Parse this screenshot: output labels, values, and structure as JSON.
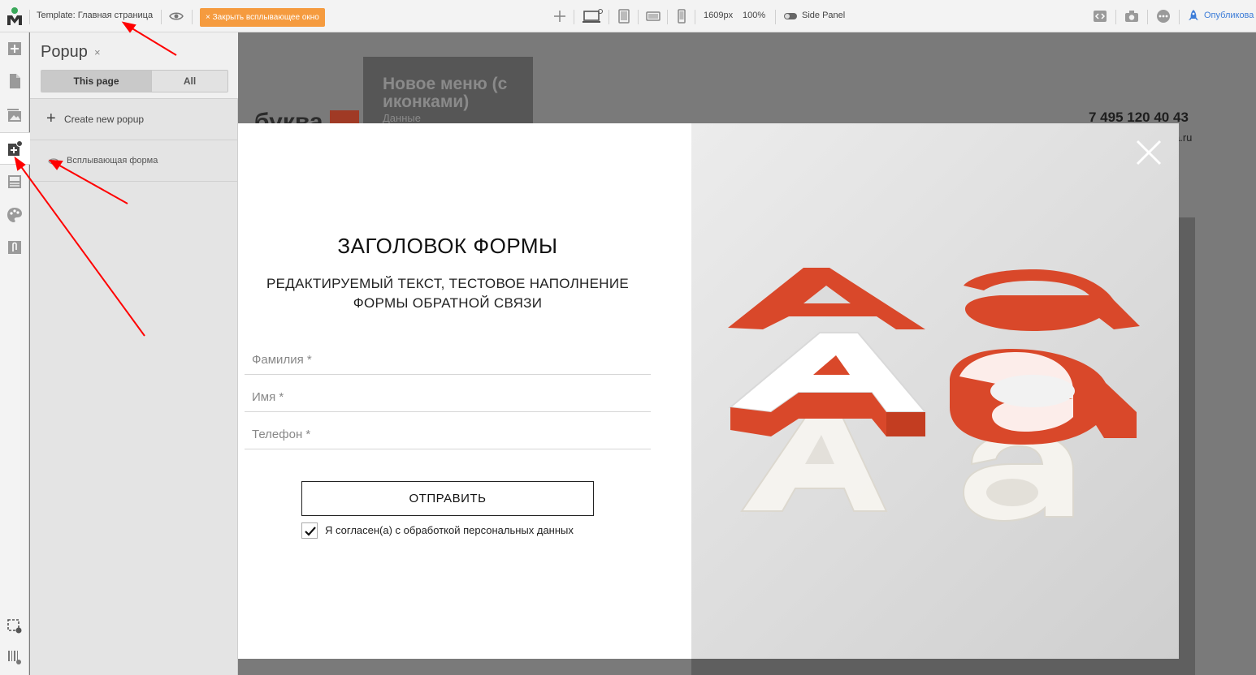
{
  "toolbar": {
    "template_label": "Template: Главная страница",
    "close_popup_label": "Закрыть всплывающее окно",
    "width_value": "1609px",
    "zoom_value": "100%",
    "side_panel_label": "Side Panel",
    "publish_label": "Опубликова"
  },
  "panel": {
    "title": "Popup",
    "close_glyph": "×",
    "tabs": [
      {
        "label": "This page",
        "active": true
      },
      {
        "label": "All",
        "active": false
      }
    ],
    "create_label": "Create new popup",
    "create_glyph": "+",
    "items": [
      {
        "label": "Всплывающая форма"
      }
    ]
  },
  "page": {
    "menu_title": "Новое меню (с иконками)",
    "menu_sub": "Данные",
    "brand": "буква",
    "phone": "7 495 120 40 43",
    "email_fragment": "a.ru"
  },
  "popup": {
    "title": "ЗАГОЛОВОК ФОРМЫ",
    "description": "РЕДАКТИРУЕМЫЙ ТЕКСТ, ТЕСТОВОЕ НАПОЛНЕНИЕ ФОРМЫ ОБРАТНОЙ СВЯЗИ",
    "fields": [
      {
        "placeholder": "Фамилия *"
      },
      {
        "placeholder": "Имя *"
      },
      {
        "placeholder": "Телефон *"
      }
    ],
    "submit_label": "ОТПРАВИТЬ",
    "consent_label": "Я согласен(а) с обработкой персональных данных",
    "consent_checked": true
  },
  "colors": {
    "accent_orange": "#f59b3f",
    "letter_red": "#d9482a",
    "annotation_red": "#ff0000",
    "logo_green": "#3aa85a"
  }
}
